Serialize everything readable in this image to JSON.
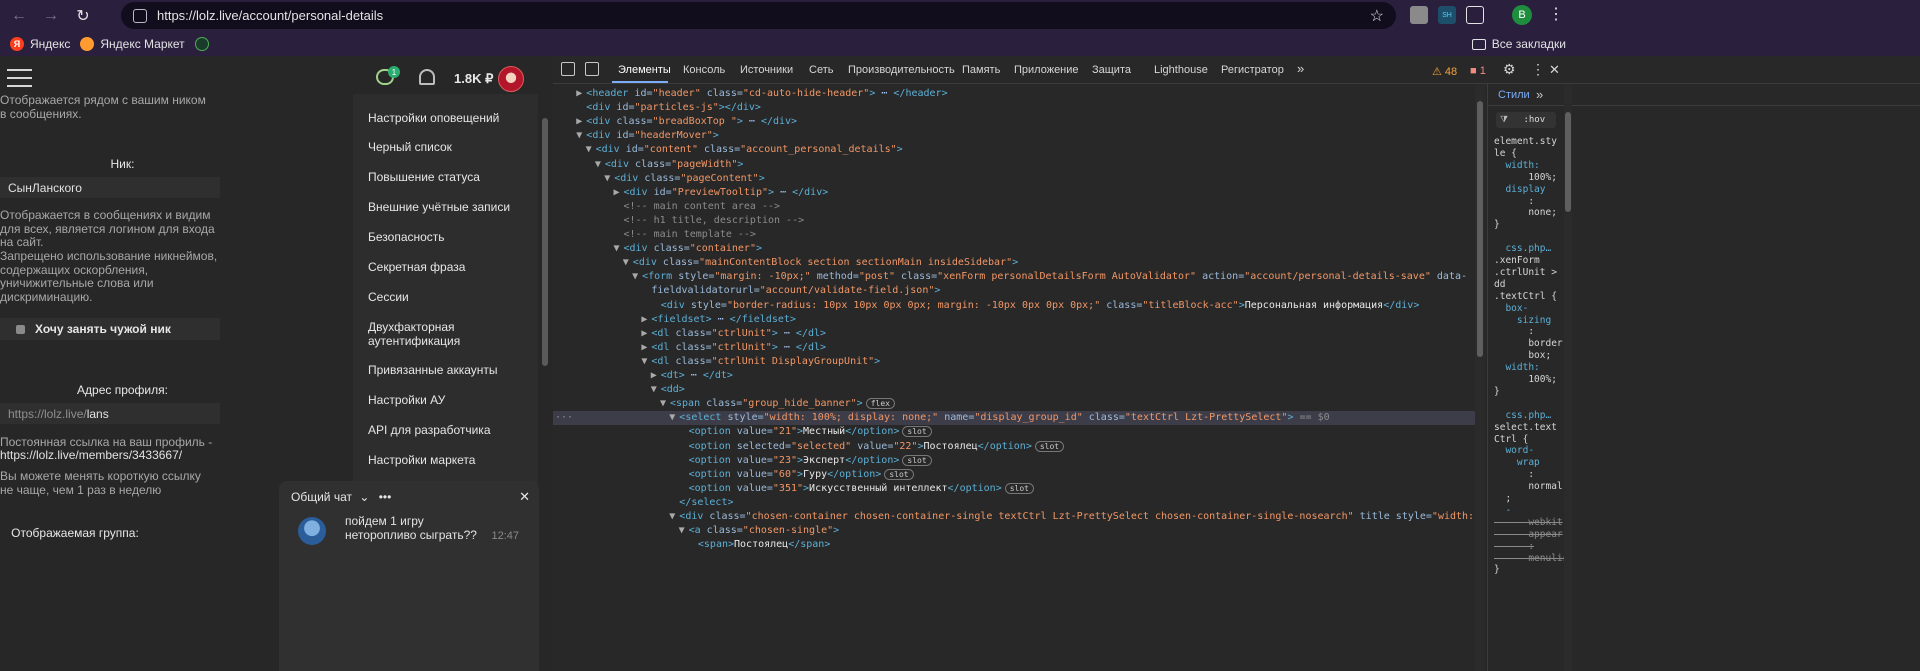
{
  "browser": {
    "url": "https://lolz.live/account/personal-details",
    "profile_initial": "B",
    "bookmarks": [
      "Яндекс",
      "Яндекс Маркет"
    ],
    "all_bookmarks": "Все закладки"
  },
  "site": {
    "balance": "1.8K ₽",
    "chat_badge": "1",
    "nick_hint_top": "Отображается рядом с вашим ником в сообщениях.",
    "nick_label": "Ник:",
    "nick_value": "СынЛанского",
    "nick_hint1": "Отображается в сообщениях и видим для всех, является логином для входа на сайт.",
    "nick_hint2": "Запрещено использование никнеймов, содержащих оскорбления, уничижительные слова или дискриминацию.",
    "take_nick": "Хочу занять чужой ник",
    "profile_label": "Адрес профиля:",
    "profile_prefix": "https://lolz.live/",
    "profile_value": "lans",
    "permalink_text": "Постоянная ссылка на ваш профиль -",
    "permalink_url": "https://lolz.live/members/3433667/",
    "change_hint": "Вы можете менять короткую ссылку не чаще, чем 1 раз в неделю",
    "group_label": "Отображаемая группа:",
    "menu": [
      "Настройки оповещений",
      "Черный список",
      "Повышение статуса",
      "Внешние учётные записи",
      "Безопасность",
      "Секретная фраза",
      "Сессии",
      "Двухфакторная аутентификация",
      "Привязанные аккаунты",
      "Настройки АУ",
      "API для разработчика",
      "Настройки маркета"
    ],
    "chat": {
      "title": "Общий чат",
      "message": "пойдем 1 игру неторопливо сыграть??",
      "time": "12:47"
    }
  },
  "devtools": {
    "tabs": [
      "Элементы",
      "Консоль",
      "Источники",
      "Сеть",
      "Производительность",
      "Память",
      "Приложение",
      "Защита",
      "Lighthouse",
      "Регистратор"
    ],
    "warnings": "48",
    "errors": "1",
    "styles_tab": "Стили",
    "filter": ":hov"
  },
  "dom_lines": [
    {
      "ind": 1,
      "tri": "▶",
      "html": "<span class='tag'>&lt;header</span> <span class='attr'>id=</span><span class='aval'>\"header\"</span> <span class='attr'>class=</span><span class='aval'>\"cd-auto-hide-header\"</span><span class='tag'>&gt;</span> ⋯ <span class='tag'>&lt;/header&gt;</span>"
    },
    {
      "ind": 1,
      "tri": " ",
      "html": "<span class='tag'>&lt;div</span> <span class='attr'>id=</span><span class='aval'>\"particles-js\"</span><span class='tag'>&gt;&lt;/div&gt;</span>"
    },
    {
      "ind": 1,
      "tri": "▶",
      "html": "<span class='tag'>&lt;div</span> <span class='attr'>class=</span><span class='aval'>\"breadBoxTop \"</span><span class='tag'>&gt;</span> ⋯ <span class='tag'>&lt;/div&gt;</span>"
    },
    {
      "ind": 1,
      "tri": "▼",
      "html": "<span class='tag'>&lt;div</span> <span class='attr'>id=</span><span class='aval'>\"headerMover\"</span><span class='tag'>&gt;</span>"
    },
    {
      "ind": 2,
      "tri": "▼",
      "html": "<span class='tag'>&lt;div</span> <span class='attr'>id=</span><span class='aval'>\"content\"</span> <span class='attr'>class=</span><span class='aval'>\"account_personal_details\"</span><span class='tag'>&gt;</span>"
    },
    {
      "ind": 3,
      "tri": "▼",
      "html": "<span class='tag'>&lt;div</span> <span class='attr'>class=</span><span class='aval'>\"pageWidth\"</span><span class='tag'>&gt;</span>"
    },
    {
      "ind": 4,
      "tri": "▼",
      "html": "<span class='tag'>&lt;div</span> <span class='attr'>class=</span><span class='aval'>\"pageContent\"</span><span class='tag'>&gt;</span>"
    },
    {
      "ind": 5,
      "tri": "▶",
      "html": "<span class='tag'>&lt;div</span> <span class='attr'>id=</span><span class='aval'>\"PreviewTooltip\"</span><span class='tag'>&gt;</span> ⋯ <span class='tag'>&lt;/div&gt;</span>"
    },
    {
      "ind": 5,
      "tri": " ",
      "html": "<span class='cmt'>&lt;!-- main content area --&gt;</span>"
    },
    {
      "ind": 5,
      "tri": " ",
      "html": "<span class='cmt'>&lt;!-- h1 title, description --&gt;</span>"
    },
    {
      "ind": 5,
      "tri": " ",
      "html": "<span class='cmt'>&lt;!-- main template --&gt;</span>"
    },
    {
      "ind": 5,
      "tri": "▼",
      "html": "<span class='tag'>&lt;div</span> <span class='attr'>class=</span><span class='aval'>\"container\"</span><span class='tag'>&gt;</span>"
    },
    {
      "ind": 6,
      "tri": "▼",
      "html": "<span class='tag'>&lt;div</span> <span class='attr'>class=</span><span class='aval'>\"mainContentBlock section sectionMain insideSidebar\"</span><span class='tag'>&gt;</span>"
    },
    {
      "ind": 7,
      "tri": "▼",
      "html": "<span class='tag'>&lt;form</span> <span class='attr'>style=</span><span class='aval'>\"margin: -10px;\"</span> <span class='attr'>method=</span><span class='aval'>\"post\"</span> <span class='attr'>class=</span><span class='aval'>\"xenForm personalDetailsForm AutoValidator\"</span> <span class='attr'>action=</span><span class='aval'>\"account/personal-details-save\"</span> <span class='attr'>data-</span>"
    },
    {
      "ind": 8,
      "tri": " ",
      "html": "<span class='attr'>fieldvalidatorurl=</span><span class='aval'>\"account/validate-field.json\"</span><span class='tag'>&gt;</span>"
    },
    {
      "ind": 9,
      "tri": " ",
      "html": "<span class='tag'>&lt;div</span> <span class='attr'>style=</span><span class='aval'>\"border-radius: 10px 10px 0px 0px; margin: -10px 0px 0px 0px;\"</span> <span class='attr'>class=</span><span class='aval'>\"titleBlock-acc\"</span><span class='tag'>&gt;</span><span class='txt'>Персональная информация</span><span class='tag'>&lt;/div&gt;</span>"
    },
    {
      "ind": 8,
      "tri": "▶",
      "html": "<span class='tag'>&lt;fieldset&gt;</span> ⋯ <span class='tag'>&lt;/fieldset&gt;</span>"
    },
    {
      "ind": 8,
      "tri": "▶",
      "html": "<span class='tag'>&lt;dl</span> <span class='attr'>class=</span><span class='aval'>\"ctrlUnit\"</span><span class='tag'>&gt;</span> ⋯ <span class='tag'>&lt;/dl&gt;</span>"
    },
    {
      "ind": 8,
      "tri": "▶",
      "html": "<span class='tag'>&lt;dl</span> <span class='attr'>class=</span><span class='aval'>\"ctrlUnit\"</span><span class='tag'>&gt;</span> ⋯ <span class='tag'>&lt;/dl&gt;</span>"
    },
    {
      "ind": 8,
      "tri": "▼",
      "html": "<span class='tag'>&lt;dl</span> <span class='attr'>class=</span><span class='aval'>\"ctrlUnit DisplayGroupUnit\"</span><span class='tag'>&gt;</span>"
    },
    {
      "ind": 9,
      "tri": "▶",
      "html": "<span class='tag'>&lt;dt&gt;</span> ⋯ <span class='tag'>&lt;/dt&gt;</span>"
    },
    {
      "ind": 9,
      "tri": "▼",
      "html": "<span class='tag'>&lt;dd&gt;</span>"
    },
    {
      "ind": 10,
      "tri": "▼",
      "html": "<span class='tag'>&lt;span</span> <span class='attr'>class=</span><span class='aval'>\"group_hide_banner\"</span><span class='tag'>&gt;</span><span class='pill'>flex</span>"
    },
    {
      "ind": 11,
      "tri": "▼",
      "sel": true,
      "html": "<span class='tag'>&lt;select</span> <span class='attr'>style=</span><span class='aval'>\"width: 100%; display: none;\"</span> <span class='attr'>name=</span><span class='aval'>\"display_group_id\"</span> <span class='attr'>class=</span><span class='aval'>\"textCtrl Lzt-PrettySelect\"</span><span class='tag'>&gt;</span> <span class='cmt'>== $0</span>"
    },
    {
      "ind": 12,
      "tri": " ",
      "html": "<span class='tag'>&lt;option</span> <span class='attr'>value=</span><span class='aval'>\"21\"</span><span class='tag'>&gt;</span><span class='txt'>Местный</span><span class='tag'>&lt;/option&gt;</span><span class='pill'>slot</span>"
    },
    {
      "ind": 12,
      "tri": " ",
      "html": "<span class='tag'>&lt;option</span> <span class='attr'>selected=</span><span class='aval'>\"selected\"</span> <span class='attr'>value=</span><span class='aval'>\"22\"</span><span class='tag'>&gt;</span><span class='txt'>Постоялец</span><span class='tag'>&lt;/option&gt;</span><span class='pill'>slot</span>"
    },
    {
      "ind": 12,
      "tri": " ",
      "html": "<span class='tag'>&lt;option</span> <span class='attr'>value=</span><span class='aval'>\"23\"</span><span class='tag'>&gt;</span><span class='txt'>Эксперт</span><span class='tag'>&lt;/option&gt;</span><span class='pill'>slot</span>"
    },
    {
      "ind": 12,
      "tri": " ",
      "html": "<span class='tag'>&lt;option</span> <span class='attr'>value=</span><span class='aval'>\"60\"</span><span class='tag'>&gt;</span><span class='txt'>Гуру</span><span class='tag'>&lt;/option&gt;</span><span class='pill'>slot</span>"
    },
    {
      "ind": 12,
      "tri": " ",
      "html": "<span class='tag'>&lt;option</span> <span class='attr'>value=</span><span class='aval'>\"351\"</span><span class='tag'>&gt;</span><span class='txt'>Искусственный интеллект</span><span class='tag'>&lt;/option&gt;</span><span class='pill'>slot</span>"
    },
    {
      "ind": 11,
      "tri": " ",
      "html": "<span class='tag'>&lt;/select&gt;</span>"
    },
    {
      "ind": 11,
      "tri": "▼",
      "html": "<span class='tag'>&lt;div</span> <span class='attr'>class=</span><span class='aval'>\"chosen-container chosen-container-single textCtrl Lzt-PrettySelect chosen-container-single-nosearch\"</span> <span class='attr'>title</span> <span class='attr'>style=</span><span class='aval'>\"width: auto;\"</span><span class='tag'>&gt;</span>"
    },
    {
      "ind": 12,
      "tri": "▼",
      "html": "<span class='tag'>&lt;a</span> <span class='attr'>class=</span><span class='aval'>\"chosen-single\"</span><span class='tag'>&gt;</span>"
    },
    {
      "ind": 13,
      "tri": " ",
      "html": "<span class='tag'>&lt;span&gt;</span><span class='txt'>Постоялец</span><span class='tag'>&lt;/span&gt;</span>"
    }
  ],
  "styles_lines": [
    "element.sty",
    "le {",
    "  width:",
    "      100%;",
    "  display",
    "      :",
    "      none;",
    "}",
    "",
    "  css.php…",
    ".xenForm",
    ".ctrlUnit >",
    "dd",
    ".textCtrl {",
    "  box-",
    "    sizing",
    "      :",
    "      border-",
    "      box;",
    "  width:",
    "      100%;",
    "}",
    "",
    "  css.php…",
    "select.text",
    "Ctrl {",
    "  word-",
    "    wrap",
    "      :",
    "      normal",
    "  ;",
    "  -",
    "      webkit",
    "      appear",
    "      :",
    "      menulis",
    "}"
  ]
}
